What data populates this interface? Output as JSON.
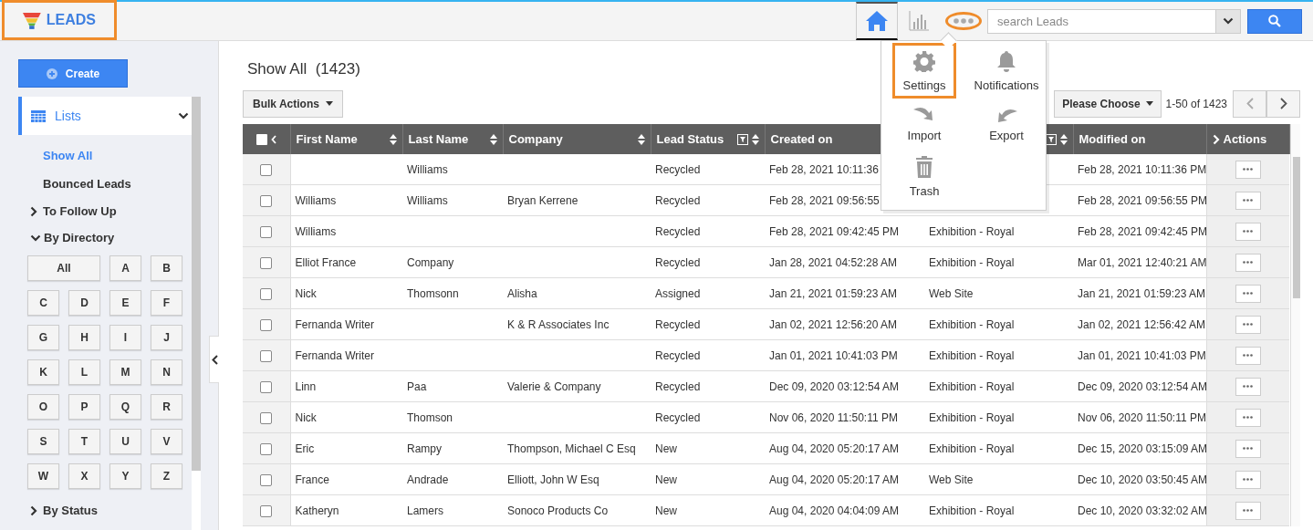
{
  "app": {
    "title": "LEADS",
    "highlighted": true
  },
  "toolbar": {
    "more_button": {
      "highlighted": true
    },
    "search": {
      "placeholder": "search Leads"
    }
  },
  "more_menu": {
    "items": [
      {
        "label": "Settings",
        "highlighted": true
      },
      {
        "label": "Notifications",
        "highlighted": false
      },
      {
        "label": "Import",
        "highlighted": false
      },
      {
        "label": "Export",
        "highlighted": false
      },
      {
        "label": "Trash",
        "highlighted": false
      }
    ]
  },
  "sidebar": {
    "create_button": "Create",
    "lists": {
      "label": "Lists",
      "expanded": true
    },
    "items": [
      {
        "kind": "link",
        "label": "Show All",
        "selected": true
      },
      {
        "kind": "link",
        "label": "Bounced Leads",
        "selected": false
      },
      {
        "kind": "group",
        "label": "To Follow Up",
        "expanded": false
      },
      {
        "kind": "group",
        "label": "By Directory",
        "expanded": true
      },
      {
        "kind": "letters",
        "letters": [
          "All",
          "A",
          "B",
          "C",
          "D",
          "E",
          "F",
          "G",
          "H",
          "I",
          "J",
          "K",
          "L",
          "M",
          "N",
          "O",
          "P",
          "Q",
          "R",
          "S",
          "T",
          "U",
          "V",
          "W",
          "X",
          "Y",
          "Z"
        ]
      },
      {
        "kind": "group",
        "label": "By Status",
        "expanded": false
      }
    ]
  },
  "main": {
    "title": "Show All",
    "count": "(1423)",
    "bulk_actions": "Bulk Actions",
    "view_select": "Please Choose",
    "page_range": "1-50 of 1423"
  },
  "table": {
    "select_all_checked": false,
    "columns": [
      {
        "label": "First Name",
        "sortable": true,
        "filter": false
      },
      {
        "label": "Last Name",
        "sortable": true,
        "filter": false
      },
      {
        "label": "Company",
        "sortable": true,
        "filter": false
      },
      {
        "label": "Lead Status",
        "sortable": true,
        "filter": true
      },
      {
        "label": "Created on"
      },
      {
        "sortable": true,
        "filter": true
      },
      {
        "label": "Modified on",
        "sortable": false,
        "filter": false
      },
      {
        "label": "Actions",
        "sortable": false,
        "filter": false
      }
    ],
    "rows": [
      {
        "checked": false,
        "cells": [
          null,
          "Williams",
          null,
          "Recycled",
          "Feb 28, 2021 10:11:36",
          null,
          "Feb 28, 2021 10:11:36 PM"
        ]
      },
      {
        "checked": false,
        "cells": [
          "Williams",
          "Williams",
          "Bryan Kerrene",
          "Recycled",
          "Feb 28, 2021 09:56:55",
          null,
          "Feb 28, 2021 09:56:55 PM"
        ]
      },
      {
        "checked": false,
        "cells": [
          "Williams",
          null,
          null,
          "Recycled",
          "Feb 28, 2021 09:42:45 PM",
          "Exhibition - Royal",
          "Feb 28, 2021 09:42:45 PM"
        ]
      },
      {
        "checked": false,
        "cells": [
          "Elliot France",
          "Company",
          null,
          "Recycled",
          "Jan 28, 2021 04:52:28 AM",
          "Exhibition - Royal",
          "Mar 01, 2021 12:40:21 AM"
        ]
      },
      {
        "checked": false,
        "cells": [
          "Nick",
          "Thomsonn",
          "Alisha",
          "Assigned",
          "Jan 21, 2021 01:59:23 AM",
          "Web Site",
          "Jan 21, 2021 01:59:23 AM"
        ]
      },
      {
        "checked": false,
        "cells": [
          "Fernanda Writer",
          null,
          "K & R Associates Inc",
          "Recycled",
          "Jan 02, 2021 12:56:20 AM",
          "Exhibition - Royal",
          "Jan 02, 2021 12:56:42 AM"
        ]
      },
      {
        "checked": false,
        "cells": [
          "Fernanda Writer",
          null,
          null,
          "Recycled",
          "Jan 01, 2021 10:41:03 PM",
          "Exhibition - Royal",
          "Jan 01, 2021 10:41:03 PM"
        ]
      },
      {
        "checked": false,
        "cells": [
          "Linn",
          "Paa",
          "Valerie & Company",
          "Recycled",
          "Dec 09, 2020 03:12:54 AM",
          "Exhibition - Royal",
          "Dec 09, 2020 03:12:54 AM"
        ]
      },
      {
        "checked": false,
        "cells": [
          "Nick",
          "Thomson",
          null,
          "Recycled",
          "Nov 06, 2020 11:50:11 PM",
          "Exhibition - Royal",
          "Nov 06, 2020 11:50:11 PM"
        ]
      },
      {
        "checked": false,
        "cells": [
          "Eric",
          "Rampy",
          "Thompson, Michael C Esq",
          "New",
          "Aug 04, 2020 05:20:17 AM",
          "Exhibition - Royal",
          "Dec 15, 2020 03:15:09 AM"
        ]
      },
      {
        "checked": false,
        "cells": [
          "France",
          "Andrade",
          "Elliott, John W Esq",
          "New",
          "Aug 04, 2020 05:20:17 AM",
          "Web Site",
          "Dec 10, 2020 03:50:45 AM"
        ]
      },
      {
        "checked": false,
        "cells": [
          "Katheryn",
          "Lamers",
          "Sonoco Products Co",
          "New",
          "Aug 04, 2020 04:04:09 AM",
          "Exhibition - Royal",
          "Dec 10, 2020 03:32:02 AM"
        ]
      }
    ]
  }
}
